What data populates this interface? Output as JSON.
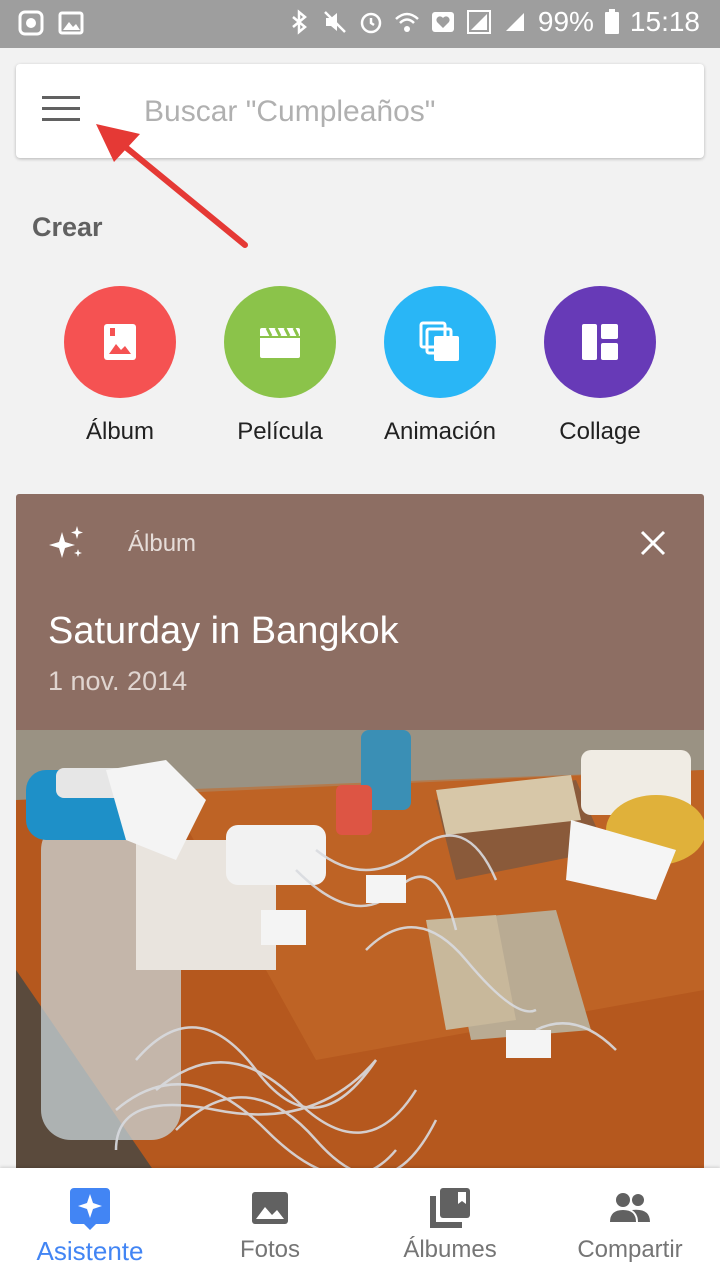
{
  "status_bar": {
    "battery": "99%",
    "time": "15:18"
  },
  "search": {
    "placeholder": "Buscar \"Cumpleaños\""
  },
  "create": {
    "title": "Crear",
    "items": [
      {
        "label": "Álbum",
        "icon": "photo-album-icon",
        "color": "#f55252"
      },
      {
        "label": "Película",
        "icon": "movie-clapper-icon",
        "color": "#8bc34a"
      },
      {
        "label": "Animación",
        "icon": "animation-stack-icon",
        "color": "#29b6f6"
      },
      {
        "label": "Collage",
        "icon": "collage-grid-icon",
        "color": "#673ab7"
      }
    ]
  },
  "suggestion_card": {
    "type_label": "Álbum",
    "title": "Saturday in Bangkok",
    "date": "1 nov. 2014",
    "header_color": "#8d6e63"
  },
  "bottom_nav": {
    "items": [
      {
        "label": "Asistente",
        "icon": "assistant-star-icon",
        "active": true
      },
      {
        "label": "Fotos",
        "icon": "photo-icon",
        "active": false
      },
      {
        "label": "Álbumes",
        "icon": "albums-icon",
        "active": false
      },
      {
        "label": "Compartir",
        "icon": "people-icon",
        "active": false
      }
    ],
    "active_color": "#4285f4"
  }
}
